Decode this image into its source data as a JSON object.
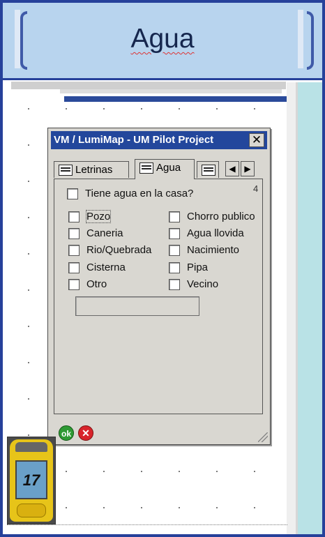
{
  "header": {
    "title": "Agua"
  },
  "dialog": {
    "title": "VM / LumiMap - UM Pilot Project",
    "close_label": "✕",
    "tabs": [
      {
        "label": "Letrinas",
        "active": false
      },
      {
        "label": "Agua",
        "active": true
      },
      {
        "label": "",
        "active": false
      }
    ],
    "nav": {
      "prev": "◀",
      "next": "▶"
    },
    "page_number": "4",
    "question": "Tiene agua en la casa?",
    "options_left": [
      "Pozo",
      "Caneria",
      "Rio/Quebrada",
      "Cisterna",
      "Otro"
    ],
    "options_right": [
      "Chorro publico",
      "Agua llovida",
      "Nacimiento",
      "Pipa",
      "Vecino"
    ],
    "other_value": "",
    "ok_label": "ok",
    "cancel_label": "✕"
  },
  "device": {
    "number": "17"
  },
  "colors": {
    "frame": "#26419a",
    "header_bg": "#b8d4ee",
    "titlebar": "#23479c",
    "strip": "#b9e2e6"
  }
}
